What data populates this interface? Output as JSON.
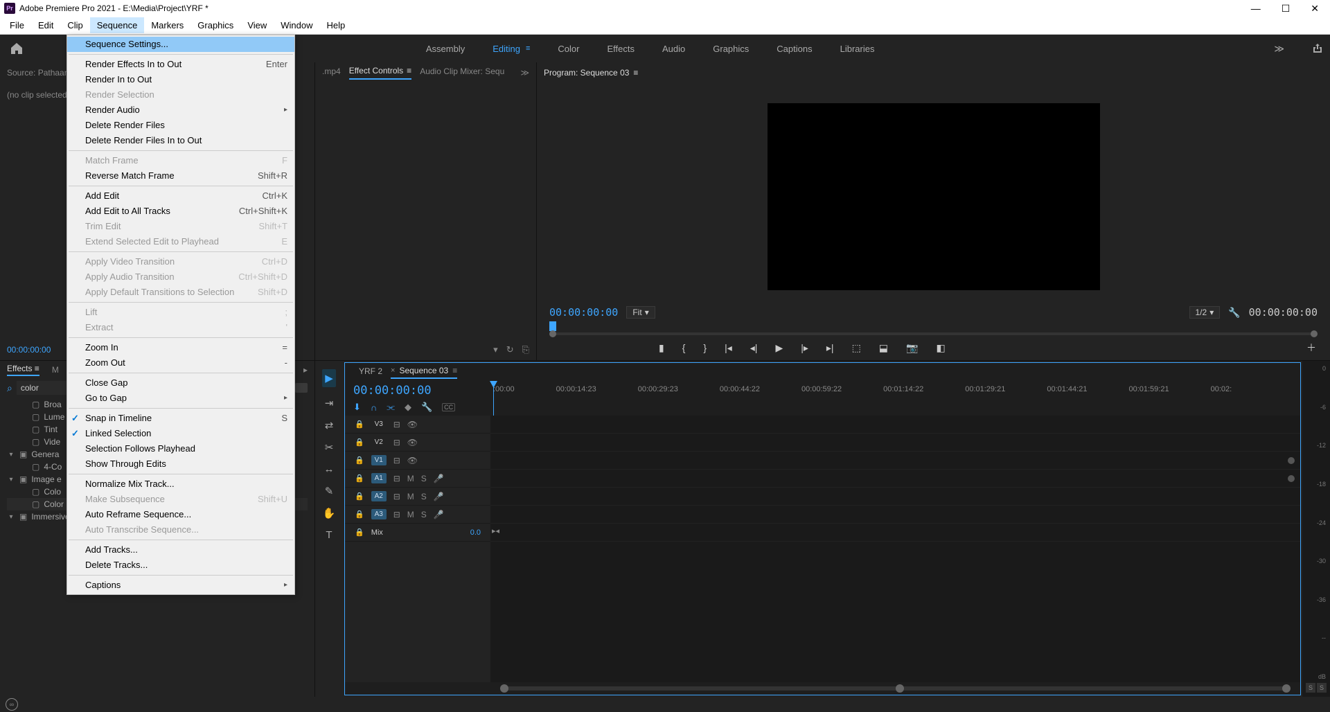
{
  "title": "Adobe Premiere Pro 2021 - E:\\Media\\Project\\YRF *",
  "menus": [
    "File",
    "Edit",
    "Clip",
    "Sequence",
    "Markers",
    "Graphics",
    "View",
    "Window",
    "Help"
  ],
  "active_menu_index": 3,
  "dropdown": [
    {
      "type": "item",
      "label": "Sequence Settings...",
      "highlighted": true
    },
    {
      "type": "sep"
    },
    {
      "type": "item",
      "label": "Render Effects In to Out",
      "shortcut": "Enter"
    },
    {
      "type": "item",
      "label": "Render In to Out"
    },
    {
      "type": "item",
      "label": "Render Selection",
      "disabled": true
    },
    {
      "type": "item",
      "label": "Render Audio",
      "submenu": true
    },
    {
      "type": "item",
      "label": "Delete Render Files"
    },
    {
      "type": "item",
      "label": "Delete Render Files In to Out"
    },
    {
      "type": "sep"
    },
    {
      "type": "item",
      "label": "Match Frame",
      "shortcut": "F",
      "disabled": true
    },
    {
      "type": "item",
      "label": "Reverse Match Frame",
      "shortcut": "Shift+R"
    },
    {
      "type": "sep"
    },
    {
      "type": "item",
      "label": "Add Edit",
      "shortcut": "Ctrl+K"
    },
    {
      "type": "item",
      "label": "Add Edit to All Tracks",
      "shortcut": "Ctrl+Shift+K"
    },
    {
      "type": "item",
      "label": "Trim Edit",
      "shortcut": "Shift+T",
      "disabled": true
    },
    {
      "type": "item",
      "label": "Extend Selected Edit to Playhead",
      "shortcut": "E",
      "disabled": true
    },
    {
      "type": "sep"
    },
    {
      "type": "item",
      "label": "Apply Video Transition",
      "shortcut": "Ctrl+D",
      "disabled": true
    },
    {
      "type": "item",
      "label": "Apply Audio Transition",
      "shortcut": "Ctrl+Shift+D",
      "disabled": true
    },
    {
      "type": "item",
      "label": "Apply Default Transitions to Selection",
      "shortcut": "Shift+D",
      "disabled": true
    },
    {
      "type": "sep"
    },
    {
      "type": "item",
      "label": "Lift",
      "shortcut": ";",
      "disabled": true
    },
    {
      "type": "item",
      "label": "Extract",
      "shortcut": "'",
      "disabled": true
    },
    {
      "type": "sep"
    },
    {
      "type": "item",
      "label": "Zoom In",
      "shortcut": "="
    },
    {
      "type": "item",
      "label": "Zoom Out",
      "shortcut": "-"
    },
    {
      "type": "sep"
    },
    {
      "type": "item",
      "label": "Close Gap"
    },
    {
      "type": "item",
      "label": "Go to Gap",
      "submenu": true
    },
    {
      "type": "sep"
    },
    {
      "type": "item",
      "label": "Snap in Timeline",
      "shortcut": "S",
      "checked": true
    },
    {
      "type": "item",
      "label": "Linked Selection",
      "checked": true
    },
    {
      "type": "item",
      "label": "Selection Follows Playhead"
    },
    {
      "type": "item",
      "label": "Show Through Edits"
    },
    {
      "type": "sep"
    },
    {
      "type": "item",
      "label": "Normalize Mix Track..."
    },
    {
      "type": "item",
      "label": "Make Subsequence",
      "shortcut": "Shift+U",
      "disabled": true
    },
    {
      "type": "item",
      "label": "Auto Reframe Sequence..."
    },
    {
      "type": "item",
      "label": "Auto Transcribe Sequence...",
      "disabled": true
    },
    {
      "type": "sep"
    },
    {
      "type": "item",
      "label": "Add Tracks..."
    },
    {
      "type": "item",
      "label": "Delete Tracks..."
    },
    {
      "type": "sep"
    },
    {
      "type": "item",
      "label": "Captions",
      "submenu": true
    }
  ],
  "workspaces": [
    "Assembly",
    "Editing",
    "Color",
    "Effects",
    "Audio",
    "Graphics",
    "Captions",
    "Libraries"
  ],
  "active_workspace_index": 1,
  "source_tab": "Source: Pathaan",
  "source_body": "(no clip selected)",
  "source_tc": "00:00:00:00",
  "center_tabs": {
    "file": ".mp4",
    "effect": "Effect Controls",
    "mixer": "Audio Clip Mixer: Sequ"
  },
  "program_tab": "Program: Sequence 03",
  "program_tc_left": "00:00:00:00",
  "program_fit": "Fit",
  "program_res": "1/2",
  "program_tc_right": "00:00:00:00",
  "effects_tab": "Effects",
  "effects_m": "M",
  "effects_search_value": "color",
  "effects_tree": [
    {
      "indent": 1,
      "icon": "preset",
      "label": "Broa"
    },
    {
      "indent": 1,
      "icon": "preset",
      "label": "Lume"
    },
    {
      "indent": 1,
      "icon": "preset",
      "label": "Tint"
    },
    {
      "indent": 1,
      "icon": "preset",
      "label": "Vide"
    },
    {
      "indent": 0,
      "icon": "folder",
      "label": "Genera",
      "twisty": "▾"
    },
    {
      "indent": 1,
      "icon": "preset",
      "label": "4-Co"
    },
    {
      "indent": 0,
      "icon": "folder",
      "label": "Image e",
      "twisty": "▾"
    },
    {
      "indent": 1,
      "icon": "preset",
      "label": "Colo"
    },
    {
      "indent": 1,
      "icon": "preset",
      "label": "Color Replace",
      "sel": true
    },
    {
      "indent": 0,
      "icon": "folder",
      "label": "Immersive Video",
      "twisty": "▾"
    }
  ],
  "timeline_tabs": [
    "YRF 2",
    "Sequence 03"
  ],
  "timeline_active_tab": 1,
  "timeline_tc": "00:00:00:00",
  "timeline_ruler": [
    ":00:00",
    "00:00:14:23",
    "00:00:29:23",
    "00:00:44:22",
    "00:00:59:22",
    "00:01:14:22",
    "00:01:29:21",
    "00:01:44:21",
    "00:01:59:21",
    "00:02:"
  ],
  "tracks": {
    "video": [
      {
        "name": "V3"
      },
      {
        "name": "V2"
      },
      {
        "name": "V1",
        "lit": true
      }
    ],
    "audio": [
      {
        "name": "A1",
        "lit": true
      },
      {
        "name": "A2",
        "lit": true
      },
      {
        "name": "A3",
        "lit": true
      }
    ],
    "mix": {
      "label": "Mix",
      "value": "0.0"
    }
  },
  "meter_scale": [
    "0",
    "-6",
    "-12",
    "-18",
    "-24",
    "-30",
    "-36",
    "--",
    "dB"
  ],
  "meter_solo": [
    "S",
    "S"
  ]
}
